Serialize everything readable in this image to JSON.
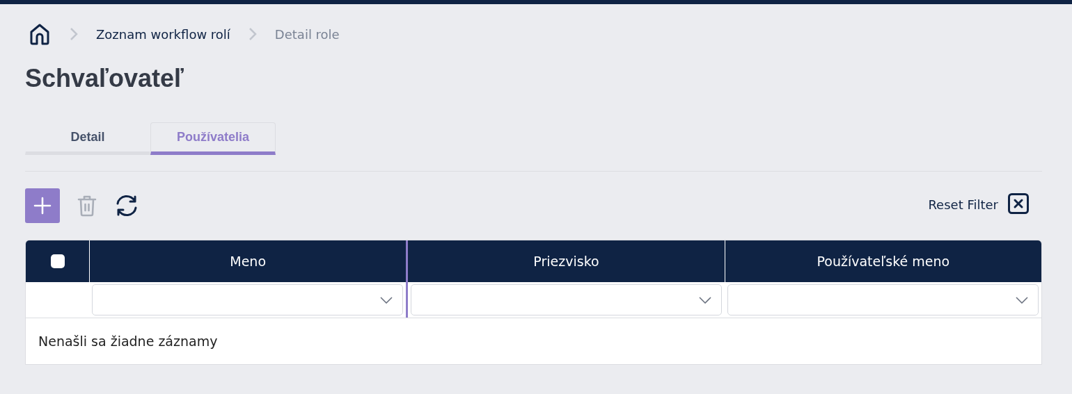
{
  "breadcrumb": [
    {
      "label": "Zoznam workflow rolí",
      "current": false
    },
    {
      "label": "Detail role",
      "current": true
    }
  ],
  "title": "Schvaľovateľ",
  "tabs": [
    {
      "label": "Detail",
      "selected": false
    },
    {
      "label": "Používatelia",
      "selected": true
    }
  ],
  "toolbar": [
    {
      "kind": "add",
      "disabled": false
    },
    {
      "kind": "delete",
      "disabled": true
    },
    {
      "kind": "refresh",
      "disabled": false
    }
  ],
  "reset_filter": {
    "label": "Reset Filter"
  },
  "table": {
    "select_all": {
      "checked": false
    },
    "columns": [
      {
        "label": "Meno"
      },
      {
        "label": "Priezvisko"
      },
      {
        "label": "Používateľské meno"
      }
    ],
    "empty_message": "Nenašli sa žiadne záznamy"
  }
}
